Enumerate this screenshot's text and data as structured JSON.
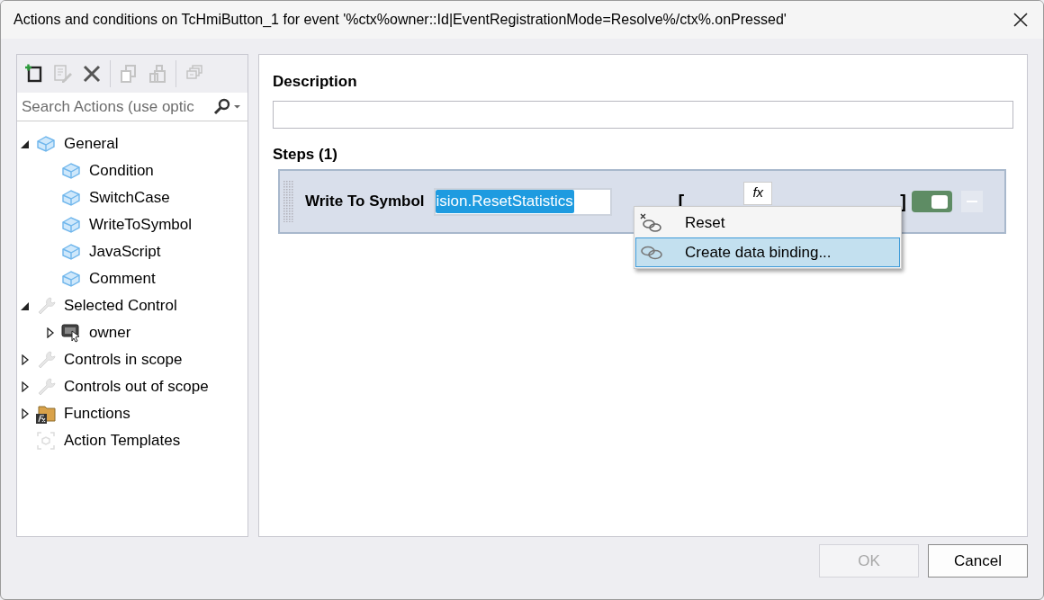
{
  "window": {
    "title": "Actions and conditions on TcHmiButton_1 for event '%ctx%owner::Id|EventRegistrationMode=Resolve%/ctx%.onPressed'"
  },
  "toolbar": [
    {
      "kind": "new",
      "disabled": false
    },
    {
      "kind": "edit",
      "disabled": true
    },
    {
      "kind": "delete",
      "disabled": false
    },
    {
      "kind": "copy",
      "disabled": true,
      "group_start": true
    },
    {
      "kind": "paste",
      "disabled": true
    },
    {
      "kind": "stack",
      "disabled": true,
      "group_start": true
    }
  ],
  "search": {
    "placeholder": "Search Actions (use optic"
  },
  "tree": [
    {
      "label": "General",
      "kind": "action",
      "expanded": true,
      "children": [
        {
          "label": "Condition",
          "kind": "action"
        },
        {
          "label": "SwitchCase",
          "kind": "action"
        },
        {
          "label": "WriteToSymbol",
          "kind": "action"
        },
        {
          "label": "JavaScript",
          "kind": "action"
        },
        {
          "label": "Comment",
          "kind": "action"
        }
      ]
    },
    {
      "label": "Selected Control",
      "kind": "wrench",
      "expanded": true,
      "children": [
        {
          "label": "owner",
          "kind": "control",
          "expanded": false
        }
      ]
    },
    {
      "label": "Controls in scope",
      "kind": "wrench",
      "expanded": false
    },
    {
      "label": "Controls out of scope",
      "kind": "wrench",
      "expanded": false
    },
    {
      "label": "Functions",
      "kind": "folder",
      "expanded": false
    },
    {
      "label": "Action Templates",
      "kind": "template"
    }
  ],
  "description": {
    "label": "Description"
  },
  "steps": {
    "label": "Steps (1)",
    "items": [
      {
        "title": "Write To Symbol",
        "symbol": "ision.ResetStatistics",
        "symbol_selected": true,
        "open_bracket": "[",
        "fx": "fx",
        "close_bracket": "]",
        "enabled": true
      }
    ]
  },
  "context_menu": [
    {
      "label": "Reset",
      "kind": "reset",
      "selected": false
    },
    {
      "label": "Create data binding...",
      "kind": "bind",
      "selected": true
    }
  ],
  "buttons": [
    {
      "label": "OK",
      "disabled": true
    },
    {
      "label": "Cancel",
      "disabled": false
    }
  ]
}
